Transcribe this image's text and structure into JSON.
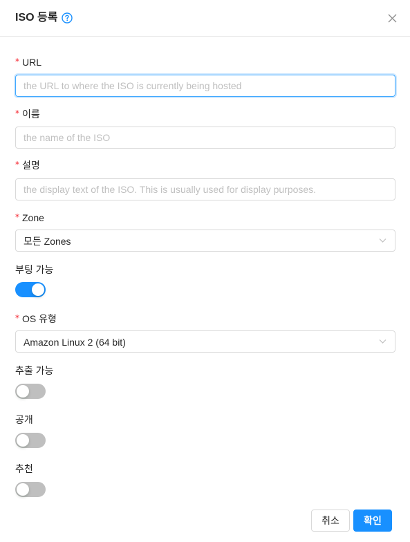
{
  "dialog": {
    "title": "ISO 등록",
    "help_icon": "question-circle-icon",
    "close_label": "X",
    "close_icon": "close-icon"
  },
  "form": {
    "url": {
      "required": "*",
      "label": "URL",
      "placeholder": "the URL to where the ISO is currently being hosted",
      "value": ""
    },
    "name": {
      "required": "*",
      "label": "이름",
      "placeholder": "the name of the ISO",
      "value": ""
    },
    "description": {
      "required": "*",
      "label": "설명",
      "placeholder": "the display text of the ISO. This is usually used for display purposes.",
      "value": ""
    },
    "zone": {
      "required": "*",
      "label": "Zone",
      "value": "모든 Zones"
    },
    "bootable": {
      "label": "부팅 가능",
      "checked": true
    },
    "os_type": {
      "required": "*",
      "label": "OS 유형",
      "value": "Amazon Linux 2 (64 bit)"
    },
    "extractable": {
      "label": "추출 가능",
      "checked": false
    },
    "public": {
      "label": "공개",
      "checked": false
    },
    "featured": {
      "label": "추천",
      "checked": false
    }
  },
  "footer": {
    "cancel_label": "취소",
    "ok_label": "확인"
  },
  "colors": {
    "primary": "#1890ff",
    "required": "#f5222d",
    "toggle_off": "#bfbfbf"
  }
}
